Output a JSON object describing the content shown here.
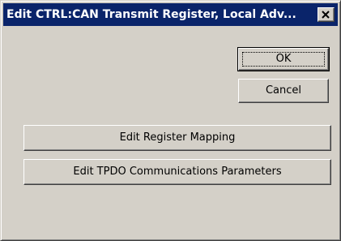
{
  "window": {
    "title": "Edit CTRL:CAN Transmit Register, Local Adv...",
    "close_icon": "close-icon"
  },
  "buttons": {
    "ok_label": "OK",
    "cancel_label": "Cancel",
    "edit_register_mapping_label": "Edit Register Mapping",
    "edit_tpdo_label": "Edit TPDO Communications Parameters"
  },
  "colors": {
    "titlebar": "#0a246a",
    "face": "#d4d0c8"
  }
}
